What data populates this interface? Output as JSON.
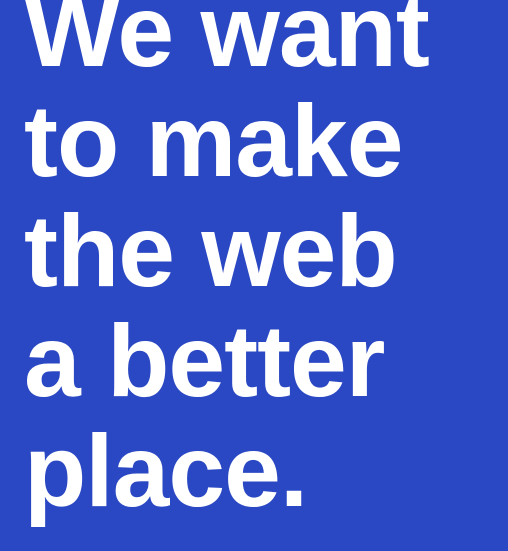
{
  "colors": {
    "background": "#2a48c3",
    "text": "#ffffff"
  },
  "headline": {
    "lines": [
      "We want",
      "to make",
      "the web",
      "a better",
      "place."
    ]
  }
}
